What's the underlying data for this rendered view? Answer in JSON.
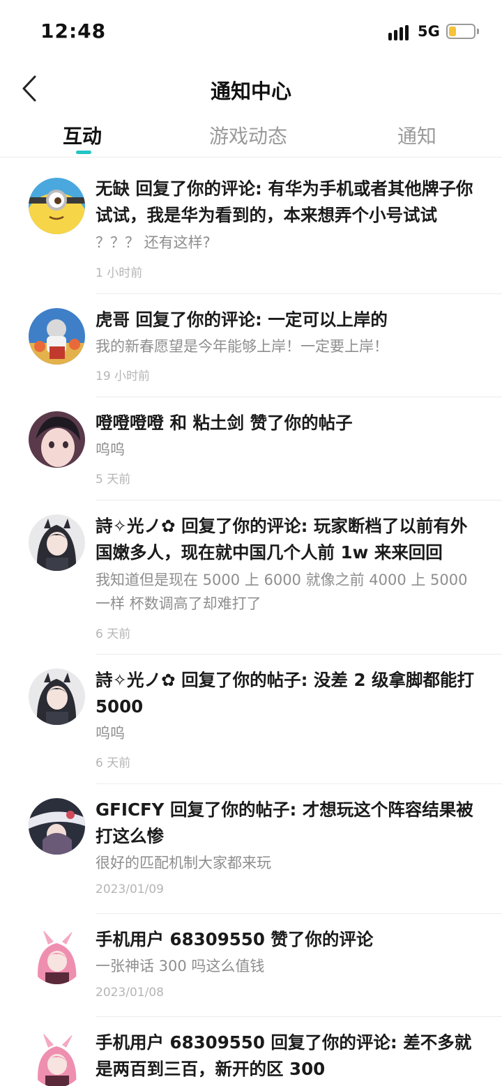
{
  "status_bar": {
    "time": "12:48",
    "network": "5G",
    "battery_level": 0.3
  },
  "header": {
    "title": "通知中心",
    "back_icon": "chevron-left-icon"
  },
  "tabs": [
    {
      "label": "互动",
      "active": true
    },
    {
      "label": "游戏动态",
      "active": false
    },
    {
      "label": "通知",
      "active": false
    }
  ],
  "colors": {
    "accent": "#23c4c4",
    "battery": "#f6c338",
    "secondary_text": "#8e8e8e",
    "time_text": "#b5b5b5"
  },
  "notifications": [
    {
      "title": "无缺 回复了你的评论: 有华为手机或者其他牌子你试试，我是华为看到的，本来想弄个小号试试",
      "content": "？？？ 还有这样?",
      "time": "1 小时前",
      "avatar": "minion-avatar"
    },
    {
      "title": "虎哥 回复了你的评论: 一定可以上岸的",
      "content": "我的新春愿望是今年能够上岸！一定要上岸！",
      "time": "19 小时前",
      "avatar": "tiger-character-avatar"
    },
    {
      "title": "噔噔噔噔 和 粘土剑 赞了你的帖子",
      "content": "呜呜",
      "time": "5 天前",
      "avatar": "anime-boy-avatar"
    },
    {
      "title": "詩✧光ノ✿ 回复了你的评论: 玩家断档了以前有外国嫩多人，现在就中国几个人前 1w 来来回回",
      "content": "我知道但是现在 5000 上 6000 就像之前 4000 上 5000 一样 杯数调高了却难打了",
      "time": "6 天前",
      "avatar": "anime-girl-dark-hair-avatar"
    },
    {
      "title": "詩✧光ノ✿ 回复了你的帖子: 没差 2 级拿脚都能打 5000",
      "content": "呜呜",
      "time": "6 天前",
      "avatar": "anime-girl-dark-hair-avatar"
    },
    {
      "title": "GFICFY 回复了你的帖子: 才想玩这个阵容结果被打这么惨",
      "content": "很好的匹配机制大家都来玩",
      "time": "2023/01/09",
      "avatar": "anime-character-avatar"
    },
    {
      "title": "手机用户 68309550 赞了你的评论",
      "content": "一张神话 300 吗这么值钱",
      "time": "2023/01/08",
      "avatar": "pink-hair-girl-avatar"
    },
    {
      "title": "手机用户 68309550 回复了你的评论: 差不多就是两百到三百，新开的区 300",
      "content": "",
      "time": "",
      "avatar": "pink-hair-girl-avatar"
    }
  ]
}
